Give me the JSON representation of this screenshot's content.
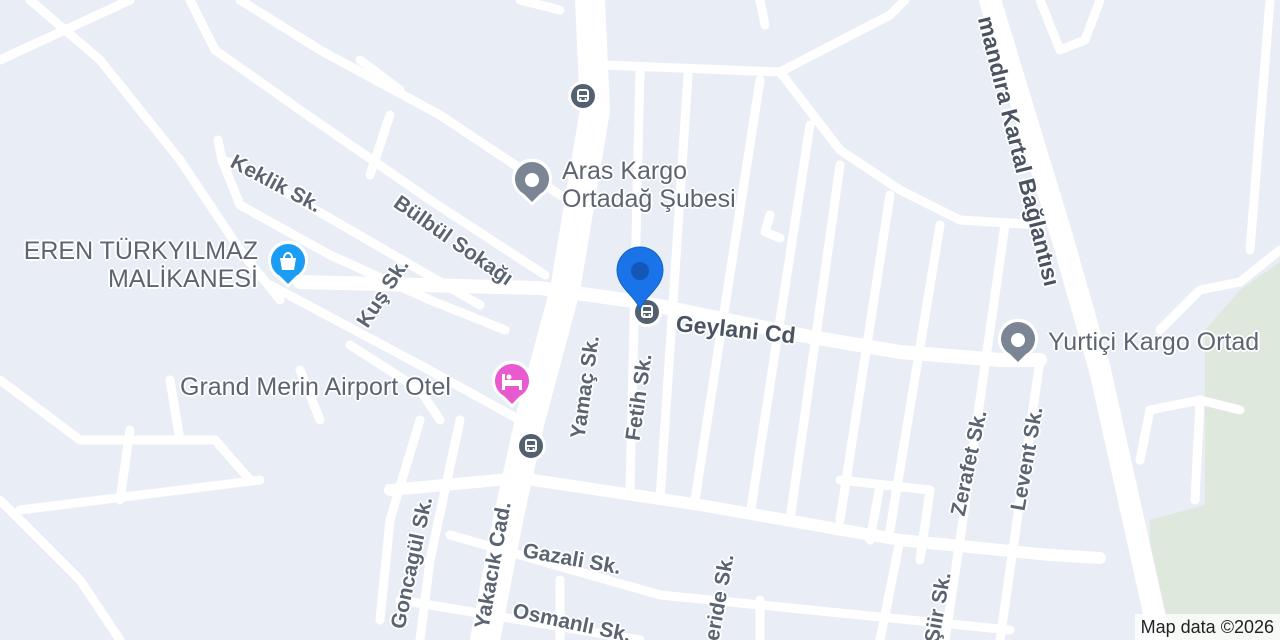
{
  "map": {
    "colors": {
      "background": "#e9edf5",
      "road": "#ffffff",
      "park": "#dfe8dc",
      "poi_gray": "#7b8594",
      "poi_blue": "#1a9df2",
      "poi_pink": "#e95ad0",
      "location_pin": "#1a73e8",
      "transit": "#53606f"
    },
    "streets": {
      "keklik": "Keklik Sk.",
      "bulbul": "Bülbül Sokağı",
      "kus": "Kuş Sk.",
      "yamac": "Yamaç Sk.",
      "fetih": "Fetih Sk.",
      "geylani": "Geylani Cd",
      "zerafet": "Zerafet Sk.",
      "levent": "Levent Sk.",
      "goncagul": "Goncagül Sk.",
      "yakacik": "Yakacık Cad.",
      "gazali": "Gazali Sk.",
      "osmanli": "Osmanlı Sk.",
      "eride": "eride Sk.",
      "siir": "Şiir Sk.",
      "kartal": "mandıra Kartal Bağlantısı"
    },
    "pois": {
      "aras": {
        "line1": "Aras Kargo",
        "line2": "Ortadağ Şubesi",
        "icon": "pin-icon"
      },
      "eren": {
        "line1": "EREN TÜRKYILMAZ",
        "line2": "MALİKANESİ",
        "icon": "shopping-bag-icon"
      },
      "grand": {
        "line1": "Grand Merin Airport Otel",
        "icon": "bed-icon"
      },
      "yurtici": {
        "line1": "Yurtiçi Kargo Ortad",
        "icon": "pin-icon"
      }
    },
    "transit_icon": "bus-icon",
    "attribution": "Map data ©2026"
  }
}
